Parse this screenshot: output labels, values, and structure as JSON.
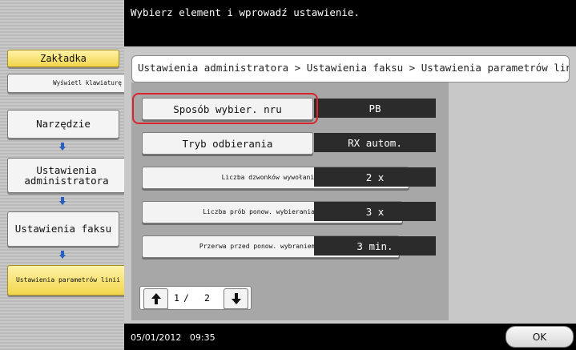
{
  "header": {
    "message": "Wybierz element i wprowadź ustawienie."
  },
  "sidebar": {
    "bookmark_label": "Zakładka",
    "keyboard_label": "Wyświetl klawiaturę",
    "steps": [
      {
        "label": "Narzędzie"
      },
      {
        "label": "Ustawienia administratora"
      },
      {
        "label": "Ustawienia faksu"
      },
      {
        "label": "Ustawienia parametrów linii"
      }
    ]
  },
  "breadcrumb": "Ustawienia administratora > Ustawienia faksu > Ustawienia parametrów linii",
  "settings": [
    {
      "label": "Sposób wybier. nru",
      "value": "PB"
    },
    {
      "label": "Tryb odbierania",
      "value": "RX autom."
    },
    {
      "label": "Liczba dzwonków wywołania RX",
      "value": "2 x"
    },
    {
      "label": "Liczba prób ponow. wybierania numeru",
      "value": "3 x"
    },
    {
      "label": "Przerwa przed ponow. wybraniem numeru",
      "value": "3 min."
    }
  ],
  "pager": {
    "current": "1",
    "separator": "/",
    "total": "2"
  },
  "footer": {
    "datetime": "05/01/2012   09:35",
    "ok_label": "OK"
  },
  "colors": {
    "highlight": "#d7252b",
    "accent_yellow": "#f2d54c",
    "arrow_blue": "#2a5fbf"
  }
}
